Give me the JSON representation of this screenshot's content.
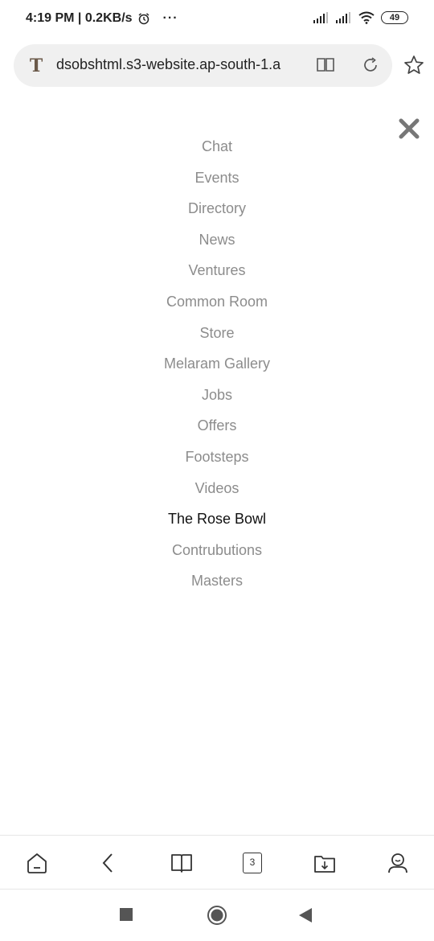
{
  "status_bar": {
    "time_speed": "4:19 PM | 0.2KB/s",
    "dots": "···",
    "battery": "49"
  },
  "browser": {
    "url": "dsobshtml.s3-website.ap-south-1.a",
    "site_icon_letter": "T"
  },
  "menu": {
    "items": [
      {
        "label": "Chat"
      },
      {
        "label": "Events"
      },
      {
        "label": "Directory"
      },
      {
        "label": "News"
      },
      {
        "label": "Ventures"
      },
      {
        "label": "Common Room"
      },
      {
        "label": "Store"
      },
      {
        "label": "Melaram Gallery"
      },
      {
        "label": "Jobs"
      },
      {
        "label": "Offers"
      },
      {
        "label": "Footsteps"
      },
      {
        "label": "Videos"
      },
      {
        "label": "The Rose Bowl"
      },
      {
        "label": "Contrubutions"
      },
      {
        "label": "Masters"
      }
    ],
    "active_index": 12
  },
  "bottom_nav": {
    "tab_count": "3"
  },
  "colors": {
    "menu_inactive": "#8c8c8c",
    "menu_active": "#111111",
    "url_bar_bg": "#f0f0f0"
  }
}
